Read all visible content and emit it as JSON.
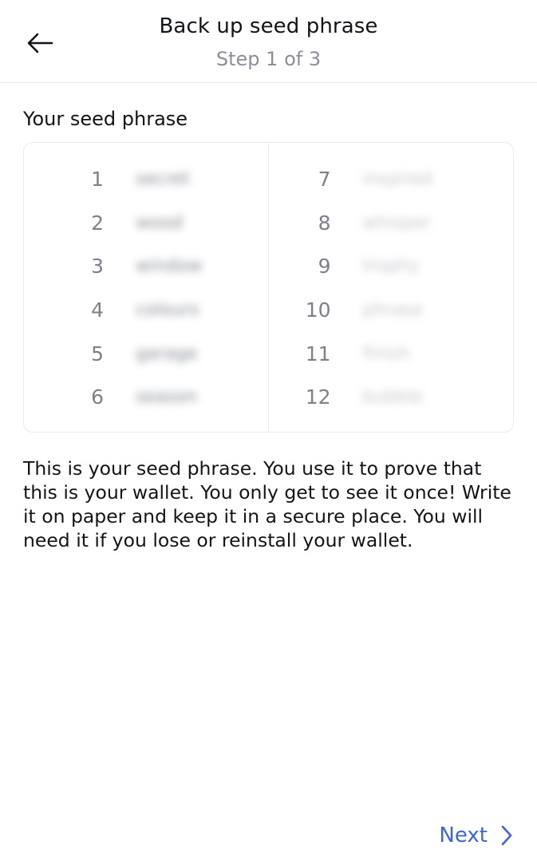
{
  "header": {
    "title": "Back up seed phrase",
    "step": "Step 1 of 3",
    "back_icon": "arrow-left-icon"
  },
  "seed": {
    "label": "Your seed phrase",
    "words": [
      {
        "n": "1",
        "word": "secret"
      },
      {
        "n": "2",
        "word": "wood"
      },
      {
        "n": "3",
        "word": "window"
      },
      {
        "n": "4",
        "word": "colours"
      },
      {
        "n": "5",
        "word": "garage"
      },
      {
        "n": "6",
        "word": "season"
      },
      {
        "n": "7",
        "word": "inspired"
      },
      {
        "n": "8",
        "word": "whisper"
      },
      {
        "n": "9",
        "word": "trophy"
      },
      {
        "n": "10",
        "word": "phrase"
      },
      {
        "n": "11",
        "word": "finish"
      },
      {
        "n": "12",
        "word": "bubble"
      }
    ]
  },
  "info": {
    "text": "This is your seed phrase. You use it to prove that this is your wallet. You only get to see it once! Write it on paper and keep it in a secure place. You will need it if you lose or reinstall your wallet."
  },
  "footer": {
    "next_label": "Next",
    "next_icon": "chevron-right-icon",
    "accent": "#3d63ea"
  }
}
